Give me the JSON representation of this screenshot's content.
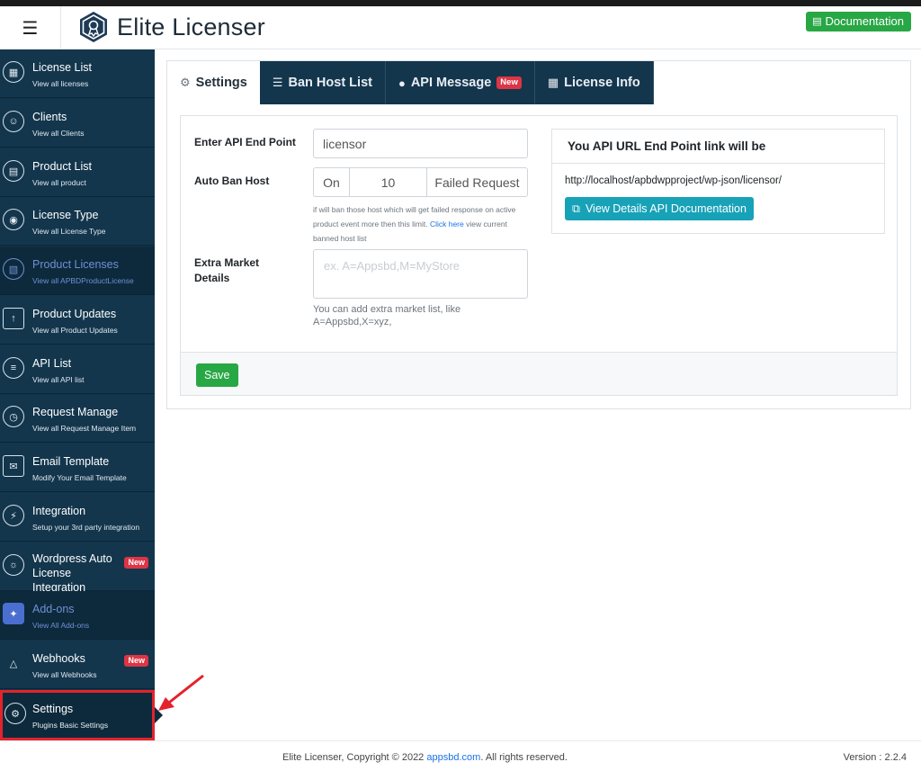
{
  "header": {
    "app_title": "Elite Licenser",
    "documentation_label": "Documentation",
    "menu_icon": "hamburger-icon",
    "logo_icon": "hexagon-badge-logo"
  },
  "sidebar": {
    "items": [
      {
        "title": "License List",
        "subtitle": "View all licenses",
        "icon": "license-icon"
      },
      {
        "title": "Clients",
        "subtitle": "View all Clients",
        "icon": "clients-icon"
      },
      {
        "title": "Product List",
        "subtitle": "View all product",
        "icon": "product-icon"
      },
      {
        "title": "License Type",
        "subtitle": "View all License Type",
        "icon": "badge-icon"
      },
      {
        "title": "Product Licenses",
        "subtitle": "View all APBDProductLicense",
        "icon": "chip-icon"
      },
      {
        "title": "Product Updates",
        "subtitle": "View all Product Updates",
        "icon": "upload-icon"
      },
      {
        "title": "API List",
        "subtitle": "View all API list",
        "icon": "api-icon"
      },
      {
        "title": "Request Manage",
        "subtitle": "View all Request Manage Item",
        "icon": "request-icon"
      },
      {
        "title": "Email Template",
        "subtitle": "Modify Your Email Template",
        "icon": "email-icon"
      },
      {
        "title": "Integration",
        "subtitle": "Setup your 3rd party integration",
        "icon": "plug-icon"
      },
      {
        "title": "Wordpress Auto License Integration",
        "subtitle": "",
        "icon": "wordpress-icon",
        "badge": "New"
      },
      {
        "title": "Add-ons",
        "subtitle": "View All Add-ons",
        "icon": "puzzle-icon"
      },
      {
        "title": "Webhooks",
        "subtitle": "View all Webhooks",
        "icon": "webhook-icon",
        "badge": "New"
      },
      {
        "title": "Settings",
        "subtitle": "Plugins Basic Settings",
        "icon": "gear-icon"
      }
    ]
  },
  "tabs": [
    {
      "label": "Settings",
      "icon": "gear-icon",
      "active": true
    },
    {
      "label": "Ban Host List",
      "icon": "list-icon"
    },
    {
      "label": "API Message",
      "icon": "chat-icon",
      "badge": "New"
    },
    {
      "label": "License Info",
      "icon": "license-icon"
    }
  ],
  "form": {
    "api_endpoint_label": "Enter API End Point",
    "api_endpoint_value": "licensor",
    "auto_ban_label": "Auto Ban Host",
    "auto_ban_toggle": "On",
    "auto_ban_count": "10",
    "auto_ban_suffix": "Failed Request",
    "auto_ban_help": "if will ban those host which will get failed response on active product event more then this limit.",
    "auto_ban_help_link": "Click here",
    "auto_ban_help_tail": "view current banned host list",
    "extra_market_label": "Extra Market Details",
    "extra_market_placeholder": "ex. A=Appsbd,M=MyStore",
    "extra_market_help": "You can add extra market list, like A=Appsbd,X=xyz,",
    "save_label": "Save"
  },
  "api_box": {
    "heading": "You API URL End Point link will be",
    "url": "http://localhost/apbdwpproject/wp-json/licensor/",
    "button_label": "View Details API Documentation"
  },
  "footer": {
    "copyright_prefix": "Elite Licenser, Copyright © 2022",
    "copyright_link": "appsbd.com",
    "copyright_suffix": ". All rights reserved.",
    "version": "Version : 2.2.4"
  },
  "colors": {
    "sidebar_bg": "#13364d",
    "sidebar_highlight": "#0d2a3c",
    "accent_green": "#28a745",
    "accent_teal": "#17a2b8",
    "badge_red": "#dc3545",
    "highlight_frame": "#e3232c"
  }
}
